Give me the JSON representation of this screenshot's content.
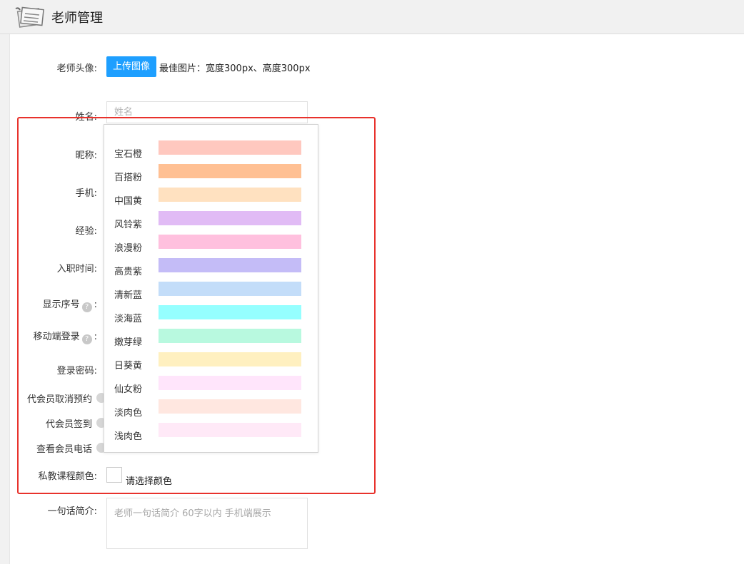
{
  "header": {
    "title": "老师管理"
  },
  "form": {
    "avatar": {
      "label": "老师头像:",
      "button": "上传图像",
      "tip": "最佳图片：宽度300px、高度300px"
    },
    "name": {
      "label": "姓名:",
      "placeholder": "姓名"
    },
    "nickname": {
      "label": "昵称:"
    },
    "phone": {
      "label": "手机:"
    },
    "experience": {
      "label": "经验:"
    },
    "hire_date": {
      "label": "入职时间:"
    },
    "display_order": {
      "label": "显示序号",
      "colon": ":",
      "help": "?"
    },
    "mobile_login": {
      "label": "移动端登录",
      "colon": ":",
      "help": "?"
    },
    "login_password": {
      "label": "登录密码:"
    },
    "cancel_booking": {
      "label": "代会员取消预约"
    },
    "check_in": {
      "label": "代会员签到"
    },
    "view_phone": {
      "label": "查看会员电话"
    },
    "course_color": {
      "label": "私教课程颜色:",
      "tip": "请选择颜色"
    },
    "intro": {
      "label": "一句话简介:",
      "placeholder": "老师一句话简介 60字以内 手机端展示"
    }
  },
  "color_options": [
    {
      "name": "宝石橙",
      "color": "#ffc8bf"
    },
    {
      "name": "百搭粉",
      "color": "#ffc093"
    },
    {
      "name": "中国黄",
      "color": "#ffe1c0"
    },
    {
      "name": "风铃紫",
      "color": "#e1bbf5"
    },
    {
      "name": "浪漫粉",
      "color": "#ffc0de"
    },
    {
      "name": "高贵紫",
      "color": "#c4bcf7"
    },
    {
      "name": "清新蓝",
      "color": "#c3ddf9"
    },
    {
      "name": "淡海蓝",
      "color": "#95ffff"
    },
    {
      "name": "嫩芽绿",
      "color": "#b8f9df"
    },
    {
      "name": "日葵黄",
      "color": "#fff0c0"
    },
    {
      "name": "仙女粉",
      "color": "#ffe5fb"
    },
    {
      "name": "淡肉色",
      "color": "#ffe7e0"
    },
    {
      "name": "浅肉色",
      "color": "#ffe9f7"
    }
  ]
}
